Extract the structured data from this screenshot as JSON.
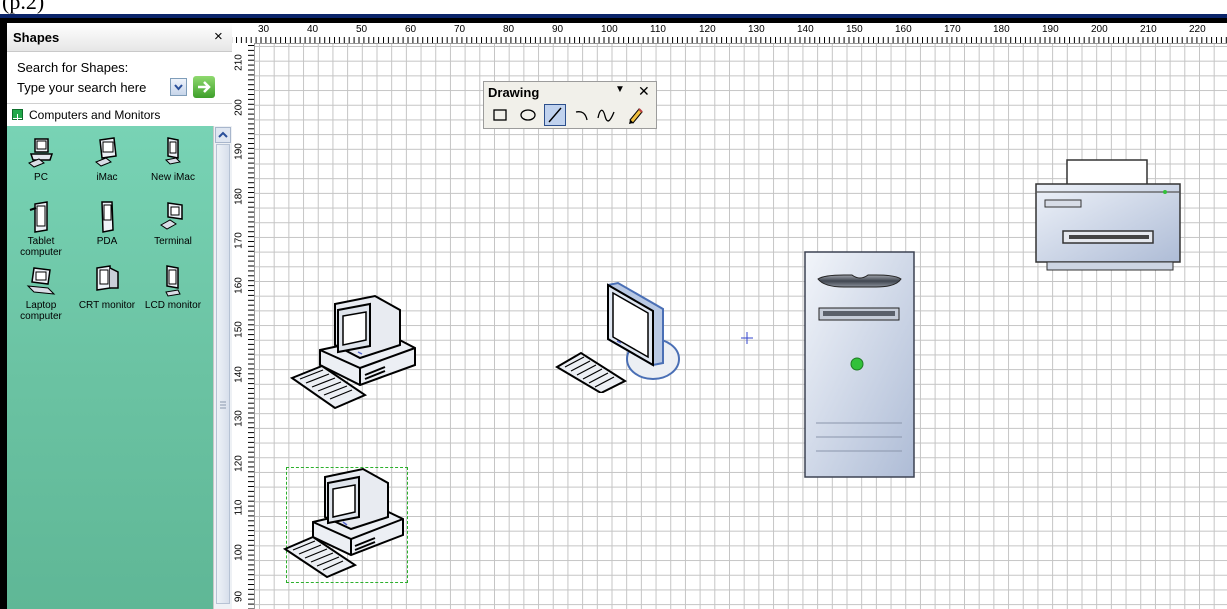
{
  "window": {
    "caption_fragment": "(p.2)"
  },
  "shapes_pane": {
    "title": "Shapes",
    "close_glyph": "×",
    "search_label": "Search for Shapes:",
    "search_placeholder": "Type your search here",
    "stencil_title": "Computers and Monitors",
    "items": [
      {
        "label": "PC",
        "icon": "pc-icon"
      },
      {
        "label": "iMac",
        "icon": "imac-icon"
      },
      {
        "label": "New iMac",
        "icon": "new-imac-icon"
      },
      {
        "label": "Tablet computer",
        "icon": "tablet-computer-icon"
      },
      {
        "label": "PDA",
        "icon": "pda-icon"
      },
      {
        "label": "Terminal",
        "icon": "terminal-icon"
      },
      {
        "label": "Laptop computer",
        "icon": "laptop-computer-icon"
      },
      {
        "label": "CRT monitor",
        "icon": "crt-monitor-icon"
      },
      {
        "label": "LCD monitor",
        "icon": "lcd-monitor-icon"
      }
    ]
  },
  "rulers": {
    "horizontal": [
      "30",
      "40",
      "50",
      "60",
      "70",
      "80",
      "90",
      "100",
      "110",
      "120",
      "130",
      "140",
      "150",
      "160",
      "170",
      "180",
      "190",
      "200",
      "210",
      "220"
    ],
    "vertical": [
      "210",
      "200",
      "190",
      "180",
      "170",
      "160",
      "150",
      "140",
      "130",
      "120",
      "110",
      "100",
      "90"
    ]
  },
  "drawing_toolbar": {
    "title": "Drawing",
    "menu_glyph": "▼",
    "close_glyph": "✕",
    "tools": [
      "rectangle-tool",
      "ellipse-tool",
      "line-tool",
      "arc-tool",
      "freeform-tool",
      "pencil-tool"
    ]
  },
  "canvas_shapes": [
    "pc",
    "pc-selected",
    "lcd-monitor",
    "tower-server",
    "printer"
  ],
  "colors": {
    "stencil_bg": "#6bc3a3",
    "grid": "#c4c4c4",
    "selection": "#2bb02b",
    "status_light": "#32c13a"
  }
}
